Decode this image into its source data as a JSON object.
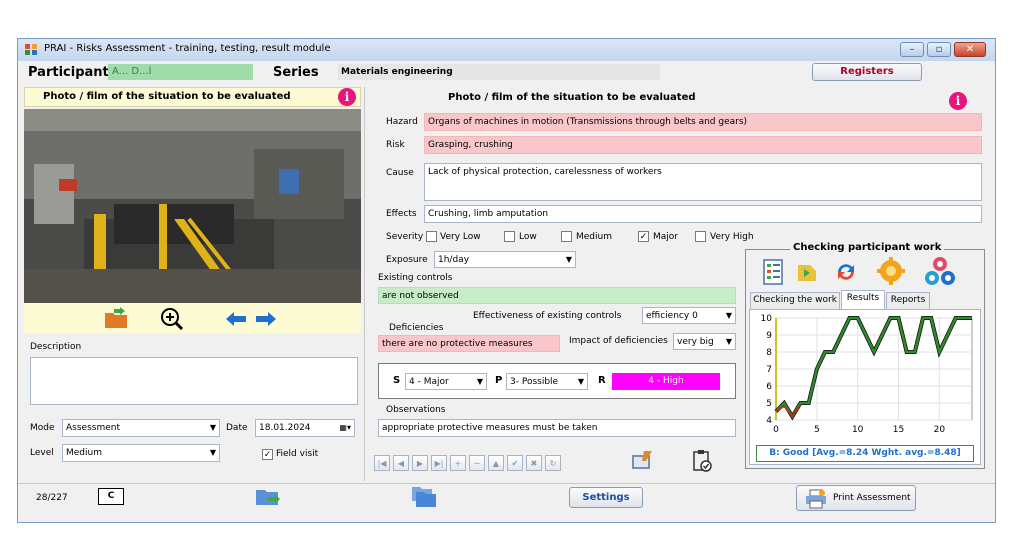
{
  "window": {
    "title": "PRAI - Risks Assessment - training, testing, result module",
    "minimize": "–",
    "maximize": "▫",
    "close": "✕"
  },
  "header": {
    "participant_label": "Participant",
    "participant_value": "A... D...l",
    "series_label": "Series",
    "series_value": "Materials engineering",
    "registers_button": "Registers"
  },
  "left": {
    "photo_header": "Photo / film of the situation to be evaluated",
    "description_label": "Description",
    "description_value": "",
    "mode_label": "Mode",
    "mode_value": "Assessment",
    "date_label": "Date",
    "date_value": "18.01.2024",
    "level_label": "Level",
    "level_value": "Medium",
    "field_visit_label": "Field visit",
    "field_visit_checked": "✓"
  },
  "center": {
    "photo_header": "Photo / film of the situation to be evaluated",
    "hazard_label": "Hazard",
    "hazard_value": "Organs of machines in motion (Transmissions through belts and gears)",
    "risk_label": "Risk",
    "risk_value": "Grasping, crushing",
    "cause_label": "Cause",
    "cause_value": "Lack of physical protection, carelessness of workers",
    "effects_label": "Effects",
    "effects_value": "Crushing, limb amputation",
    "severity_label": "Severity",
    "severity_options": [
      {
        "label": "Very Low",
        "mark": ""
      },
      {
        "label": "Low",
        "mark": ""
      },
      {
        "label": "Medium",
        "mark": ""
      },
      {
        "label": "Major",
        "mark": "✓"
      },
      {
        "label": "Very High",
        "mark": ""
      }
    ],
    "exposure_label": "Exposure",
    "exposure_value": "1h/day",
    "existing_controls_label": "Existing controls",
    "existing_controls_value": "are not observed",
    "effectiveness_label": "Effectiveness of existing controls",
    "effectiveness_value": "efficiency 0",
    "deficiencies_label": "Deficiencies",
    "deficiencies_value": "there are no protective measures",
    "impact_label": "Impact of deficiencies",
    "impact_value": "very big",
    "s_label": "S",
    "s_value": "4 - Major",
    "p_label": "P",
    "p_value": "3- Possible",
    "r_label": "R",
    "r_value": "4 - High",
    "observations_label": "Observations",
    "observations_value": "appropriate protective measures must be taken",
    "nav_buttons": [
      "|◀",
      "◀",
      "▶",
      "▶|",
      "+",
      "−",
      "▲",
      "✔",
      "✖",
      "↻"
    ]
  },
  "right": {
    "group_title": "Checking participant work",
    "tabs": [
      "Checking the work",
      "Results",
      "Reports"
    ],
    "summary": "B: Good [Avg.=8.24 Wght. avg.=8.48]"
  },
  "footer": {
    "record_counter": "28/227",
    "c_button": "C",
    "settings_button": "Settings",
    "print_button": "Print Assessment"
  },
  "chart_data": {
    "type": "line",
    "xlim": [
      0,
      24
    ],
    "ylim": [
      4,
      10
    ],
    "x_ticks": [
      "0",
      "5",
      "10",
      "15",
      "20"
    ],
    "y_ticks": [
      "4",
      "5",
      "6",
      "7",
      "8",
      "9",
      "10"
    ],
    "series": [
      {
        "color": "#2e8b2e",
        "x": [
          0,
          1,
          2,
          3,
          4,
          5,
          6,
          7,
          8,
          9,
          10,
          11,
          12,
          13,
          14,
          15,
          16,
          17,
          18,
          19,
          20,
          21,
          22,
          23,
          24
        ],
        "y": [
          4.5,
          5,
          4.2,
          5,
          5,
          7,
          8,
          8,
          9,
          10,
          10,
          9,
          8,
          9,
          10,
          10,
          8,
          8,
          10,
          10,
          8,
          9,
          10,
          10,
          10
        ]
      },
      {
        "color": "#cc2222",
        "x": [
          0,
          1,
          2,
          3
        ],
        "y": [
          4.5,
          4.8,
          4.2,
          4.9
        ]
      }
    ]
  },
  "colors": {
    "accent_pink": "#f9c6c9",
    "accent_green": "#c8ecc8",
    "risk_high": "#ff00ff",
    "info": "#e8157c"
  }
}
